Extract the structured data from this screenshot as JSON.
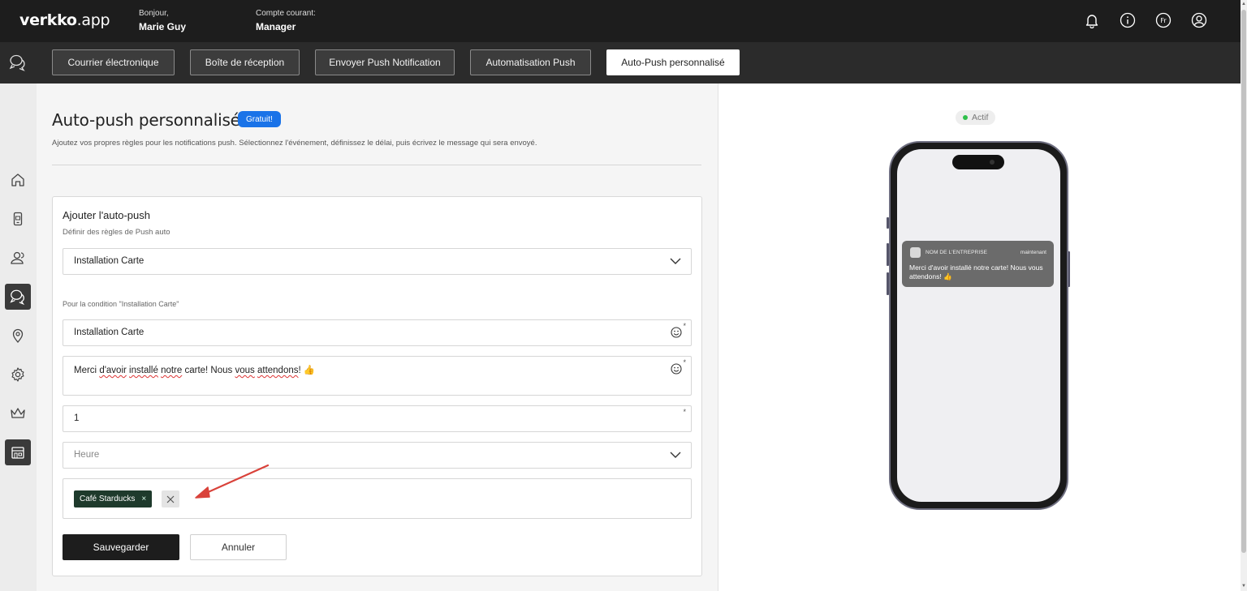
{
  "header": {
    "logo_bold": "verkko",
    "logo_rest": ".app",
    "greeting_label": "Bonjour,",
    "user_name": "Marie Guy",
    "account_label": "Compte courant:",
    "account_role": "Manager",
    "icons": [
      "bell-icon",
      "info-icon",
      "language-icon",
      "profile-icon"
    ],
    "language": "Fr"
  },
  "tabs": [
    {
      "label": "Courrier électronique"
    },
    {
      "label": "Boîte de réception"
    },
    {
      "label": "Envoyer Push Notification"
    },
    {
      "label": "Automatisation Push"
    },
    {
      "label": "Auto-Push personnalisé",
      "active": true
    }
  ],
  "sidebar": {
    "items": [
      "home-icon",
      "mobile-card-icon",
      "users-icon",
      "messages-icon",
      "location-icon",
      "settings-icon",
      "crown-icon",
      "store-icon"
    ],
    "active_index": 3
  },
  "page": {
    "title": "Auto-push personnalisé",
    "badge": "Gratuit!",
    "subtitle": "Ajoutez vos propres règles pour les notifications push. Sélectionnez l'événement, définissez le délai, puis écrivez le message qui sera envoyé."
  },
  "form": {
    "title": "Ajouter l'auto-push",
    "subtitle": "Définir des règles de Push auto",
    "event_value": "Installation Carte",
    "condition_label": "Pour la condition \"Installation Carte\"",
    "title_value": "Installation Carte",
    "message_parts": [
      "Merci ",
      "d'avoir",
      " ",
      "installé",
      " ",
      "notre",
      " carte! Nous ",
      "vous",
      " ",
      "attendons",
      "! 👍"
    ],
    "delay_value": "1",
    "unit_placeholder": "Heure",
    "required_mark": "*",
    "selected_store": "Café Starducks",
    "chip_remove": "×",
    "save_label": "Sauvegarder",
    "cancel_label": "Annuler"
  },
  "preview": {
    "status": "Actif",
    "status_color": "#2fbf4a",
    "notification": {
      "app_name": "NOM DE L'ENTREPRISE",
      "time": "maintenant",
      "body": "Merci d'avoir installé notre carte! Nous vous attendons! 👍"
    }
  },
  "colors": {
    "topbar": "#1d1d1d",
    "badge": "#1a73e8",
    "chip": "#1e3a2c",
    "annotation_arrow": "#d9423a"
  }
}
